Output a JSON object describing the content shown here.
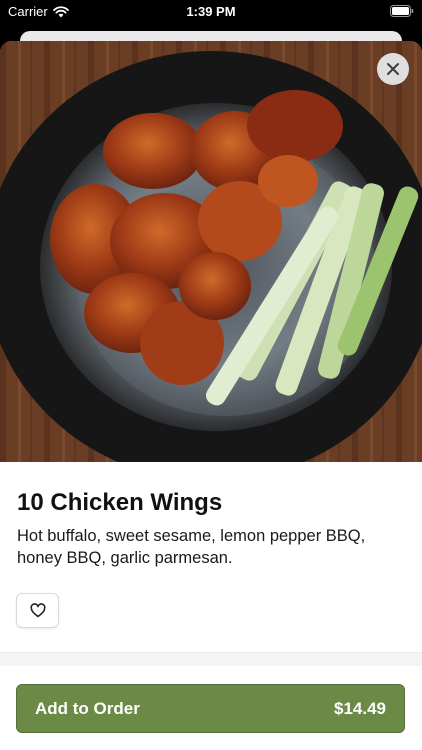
{
  "status_bar": {
    "carrier": "Carrier",
    "time": "1:39 PM",
    "icons": [
      "wifi-icon",
      "battery-icon"
    ]
  },
  "product": {
    "title": "10 Chicken Wings",
    "description": "Hot buffalo, sweet sesame, lemon pepper BBQ, honey BBQ, garlic parmesan."
  },
  "actions": {
    "close_icon": "close-icon",
    "favorite_icon": "heart-icon"
  },
  "footer": {
    "add_label": "Add to Order",
    "price": "$14.49"
  },
  "colors": {
    "accent": "#6b8a45",
    "wood": "#6d4127",
    "bowl": "#1f1f1f"
  }
}
